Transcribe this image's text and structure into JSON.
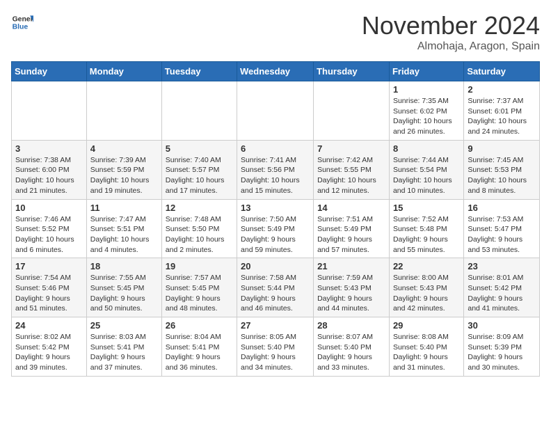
{
  "header": {
    "logo_general": "General",
    "logo_blue": "Blue",
    "month_title": "November 2024",
    "location": "Almohaja, Aragon, Spain"
  },
  "weekdays": [
    "Sunday",
    "Monday",
    "Tuesday",
    "Wednesday",
    "Thursday",
    "Friday",
    "Saturday"
  ],
  "weeks": [
    [
      {
        "day": "",
        "info": ""
      },
      {
        "day": "",
        "info": ""
      },
      {
        "day": "",
        "info": ""
      },
      {
        "day": "",
        "info": ""
      },
      {
        "day": "",
        "info": ""
      },
      {
        "day": "1",
        "info": "Sunrise: 7:35 AM\nSunset: 6:02 PM\nDaylight: 10 hours and 26 minutes."
      },
      {
        "day": "2",
        "info": "Sunrise: 7:37 AM\nSunset: 6:01 PM\nDaylight: 10 hours and 24 minutes."
      }
    ],
    [
      {
        "day": "3",
        "info": "Sunrise: 7:38 AM\nSunset: 6:00 PM\nDaylight: 10 hours and 21 minutes."
      },
      {
        "day": "4",
        "info": "Sunrise: 7:39 AM\nSunset: 5:59 PM\nDaylight: 10 hours and 19 minutes."
      },
      {
        "day": "5",
        "info": "Sunrise: 7:40 AM\nSunset: 5:57 PM\nDaylight: 10 hours and 17 minutes."
      },
      {
        "day": "6",
        "info": "Sunrise: 7:41 AM\nSunset: 5:56 PM\nDaylight: 10 hours and 15 minutes."
      },
      {
        "day": "7",
        "info": "Sunrise: 7:42 AM\nSunset: 5:55 PM\nDaylight: 10 hours and 12 minutes."
      },
      {
        "day": "8",
        "info": "Sunrise: 7:44 AM\nSunset: 5:54 PM\nDaylight: 10 hours and 10 minutes."
      },
      {
        "day": "9",
        "info": "Sunrise: 7:45 AM\nSunset: 5:53 PM\nDaylight: 10 hours and 8 minutes."
      }
    ],
    [
      {
        "day": "10",
        "info": "Sunrise: 7:46 AM\nSunset: 5:52 PM\nDaylight: 10 hours and 6 minutes."
      },
      {
        "day": "11",
        "info": "Sunrise: 7:47 AM\nSunset: 5:51 PM\nDaylight: 10 hours and 4 minutes."
      },
      {
        "day": "12",
        "info": "Sunrise: 7:48 AM\nSunset: 5:50 PM\nDaylight: 10 hours and 2 minutes."
      },
      {
        "day": "13",
        "info": "Sunrise: 7:50 AM\nSunset: 5:49 PM\nDaylight: 9 hours and 59 minutes."
      },
      {
        "day": "14",
        "info": "Sunrise: 7:51 AM\nSunset: 5:49 PM\nDaylight: 9 hours and 57 minutes."
      },
      {
        "day": "15",
        "info": "Sunrise: 7:52 AM\nSunset: 5:48 PM\nDaylight: 9 hours and 55 minutes."
      },
      {
        "day": "16",
        "info": "Sunrise: 7:53 AM\nSunset: 5:47 PM\nDaylight: 9 hours and 53 minutes."
      }
    ],
    [
      {
        "day": "17",
        "info": "Sunrise: 7:54 AM\nSunset: 5:46 PM\nDaylight: 9 hours and 51 minutes."
      },
      {
        "day": "18",
        "info": "Sunrise: 7:55 AM\nSunset: 5:45 PM\nDaylight: 9 hours and 50 minutes."
      },
      {
        "day": "19",
        "info": "Sunrise: 7:57 AM\nSunset: 5:45 PM\nDaylight: 9 hours and 48 minutes."
      },
      {
        "day": "20",
        "info": "Sunrise: 7:58 AM\nSunset: 5:44 PM\nDaylight: 9 hours and 46 minutes."
      },
      {
        "day": "21",
        "info": "Sunrise: 7:59 AM\nSunset: 5:43 PM\nDaylight: 9 hours and 44 minutes."
      },
      {
        "day": "22",
        "info": "Sunrise: 8:00 AM\nSunset: 5:43 PM\nDaylight: 9 hours and 42 minutes."
      },
      {
        "day": "23",
        "info": "Sunrise: 8:01 AM\nSunset: 5:42 PM\nDaylight: 9 hours and 41 minutes."
      }
    ],
    [
      {
        "day": "24",
        "info": "Sunrise: 8:02 AM\nSunset: 5:42 PM\nDaylight: 9 hours and 39 minutes."
      },
      {
        "day": "25",
        "info": "Sunrise: 8:03 AM\nSunset: 5:41 PM\nDaylight: 9 hours and 37 minutes."
      },
      {
        "day": "26",
        "info": "Sunrise: 8:04 AM\nSunset: 5:41 PM\nDaylight: 9 hours and 36 minutes."
      },
      {
        "day": "27",
        "info": "Sunrise: 8:05 AM\nSunset: 5:40 PM\nDaylight: 9 hours and 34 minutes."
      },
      {
        "day": "28",
        "info": "Sunrise: 8:07 AM\nSunset: 5:40 PM\nDaylight: 9 hours and 33 minutes."
      },
      {
        "day": "29",
        "info": "Sunrise: 8:08 AM\nSunset: 5:40 PM\nDaylight: 9 hours and 31 minutes."
      },
      {
        "day": "30",
        "info": "Sunrise: 8:09 AM\nSunset: 5:39 PM\nDaylight: 9 hours and 30 minutes."
      }
    ]
  ]
}
